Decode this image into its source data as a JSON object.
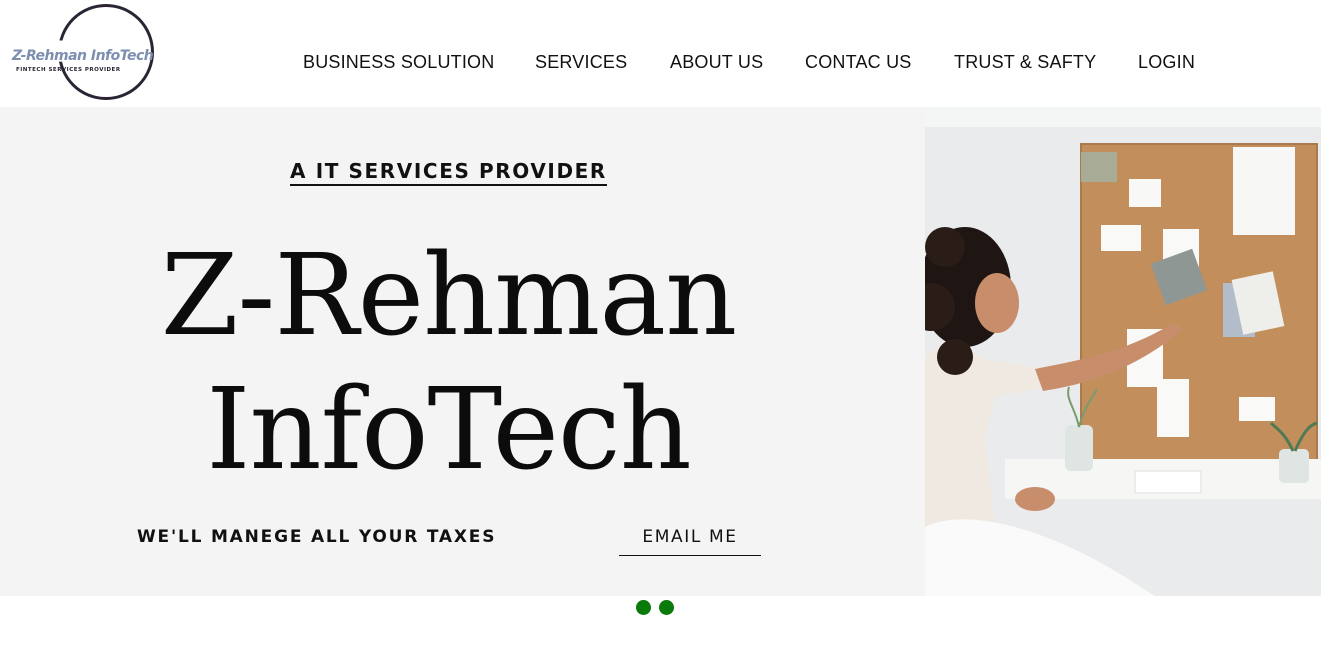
{
  "logo": {
    "title": "Z-Rehman InfoTech",
    "subtitle": "FINTECH SERVICES PROVIDER"
  },
  "nav": {
    "items": [
      {
        "label": "BUSINESS SOLUTION"
      },
      {
        "label": "SERVICES"
      },
      {
        "label": "ABOUT US"
      },
      {
        "label": "CONTAC US"
      },
      {
        "label": "TRUST & SAFTY"
      },
      {
        "label": "LOGIN"
      }
    ]
  },
  "hero": {
    "kicker": "A IT SERVICES PROVIDER",
    "headline_line1": "Z-Rehman",
    "headline_line2": "InfoTech",
    "tagline": "WE'LL MANEGE ALL YOUR TAXES",
    "cta_label": "EMAIL ME",
    "background": "#f4f4f4"
  },
  "carousel": {
    "dot_count": 2,
    "dot_color": "#0a7a0a"
  },
  "colors": {
    "text": "#111111",
    "logo_accent": "#7d8fb0",
    "logo_ring": "#2b2433"
  }
}
